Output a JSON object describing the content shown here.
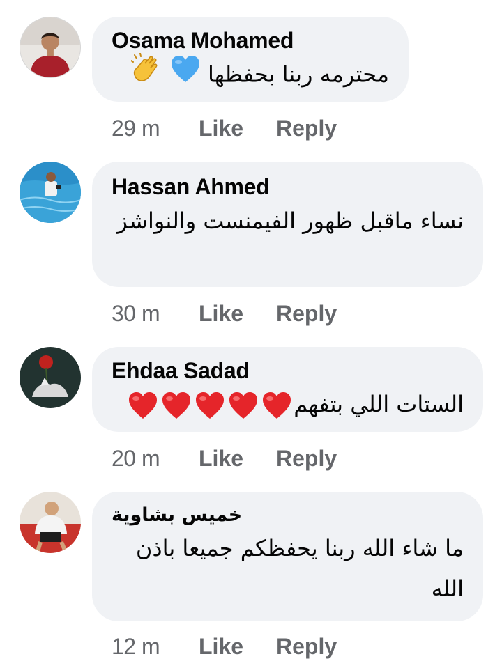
{
  "comments": [
    {
      "author": "Osama Mohamed",
      "text": "محترمه ربنا بحفظها",
      "emojis": [
        "clapping-hands",
        "blue-heart"
      ],
      "time": "29 m",
      "like_label": "Like",
      "reply_label": "Reply"
    },
    {
      "author": "Hassan Ahmed",
      "text": "نساء ماقبل ظهور الفيمنست والنواشز",
      "emojis": [],
      "time": "30 m",
      "like_label": "Like",
      "reply_label": "Reply"
    },
    {
      "author": "Ehdaa Sadad",
      "text": "الستات اللي بتفهم",
      "emojis": [
        "red-heart",
        "red-heart",
        "red-heart",
        "red-heart",
        "red-heart"
      ],
      "time": "20 m",
      "like_label": "Like",
      "reply_label": "Reply"
    },
    {
      "author": "خميس بشاوية",
      "text": "ما شاء الله ربنا يحفظكم جميعا باذن الله",
      "emojis": [],
      "time": "12 m",
      "like_label": "Like",
      "reply_label": "Reply"
    }
  ],
  "colors": {
    "bubble_bg": "#f0f2f5",
    "meta_text": "#65676b",
    "author_text": "#050505",
    "heart_red": "#e5252a",
    "heart_blue": "#4aa8f0"
  }
}
